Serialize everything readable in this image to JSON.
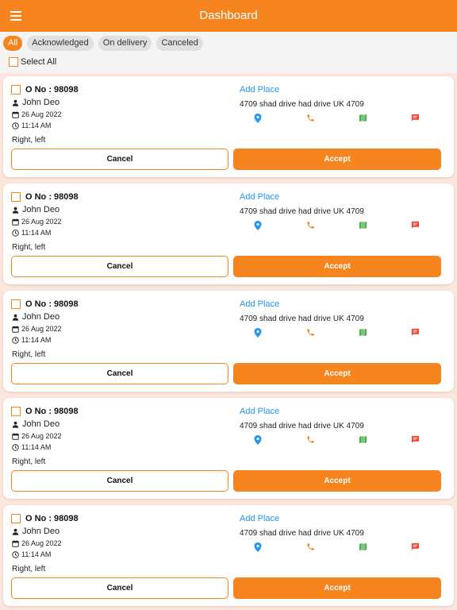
{
  "header": {
    "title": "Dashboard",
    "menu_icon": "menu-icon"
  },
  "filters": {
    "chips": [
      {
        "label": "All",
        "active": true
      },
      {
        "label": "Acknowledged",
        "active": false
      },
      {
        "label": "On delivery",
        "active": false
      },
      {
        "label": "Canceled",
        "active": false
      }
    ],
    "select_all_label": "Select All"
  },
  "orders": [
    {
      "order_no": "O No : 98098",
      "customer": "John Deo",
      "date": "26 Aug 2022",
      "time": "11:14 AM",
      "note": "Right, left",
      "add_place": "Add Place",
      "address": "4709 shad drive had drive UK 4709",
      "cancel_label": "Cancel",
      "accept_label": "Accept"
    },
    {
      "order_no": "O No : 98098",
      "customer": "John Deo",
      "date": "26 Aug 2022",
      "time": "11:14 AM",
      "note": "Right, left",
      "add_place": "Add Place",
      "address": "4709 shad drive had drive UK 4709",
      "cancel_label": "Cancel",
      "accept_label": "Accept"
    },
    {
      "order_no": "O No : 98098",
      "customer": "John Deo",
      "date": "26 Aug 2022",
      "time": "11:14 AM",
      "note": "Right, left",
      "add_place": "Add Place",
      "address": "4709 shad drive had drive UK 4709",
      "cancel_label": "Cancel",
      "accept_label": "Accept"
    },
    {
      "order_no": "O No : 98098",
      "customer": "John Deo",
      "date": "26 Aug 2022",
      "time": "11:14 AM",
      "note": "Right, left",
      "add_place": "Add Place",
      "address": "4709 shad drive had drive UK 4709",
      "cancel_label": "Cancel",
      "accept_label": "Accept"
    },
    {
      "order_no": "O No : 98098",
      "customer": "John Deo",
      "date": "26 Aug 2022",
      "time": "11:14 AM",
      "note": "Right, left",
      "add_place": "Add Place",
      "address": "4709 shad drive had drive UK 4709",
      "cancel_label": "Cancel",
      "accept_label": "Accept"
    }
  ],
  "colors": {
    "primary": "#f6841f",
    "link": "#2196f3",
    "location": "#2196f3",
    "phone": "#f6841f",
    "map": "#4caf50",
    "message": "#f44336",
    "background": "#fde7dd"
  },
  "action_icons": [
    "location-pin-icon",
    "phone-icon",
    "map-icon",
    "message-icon"
  ]
}
